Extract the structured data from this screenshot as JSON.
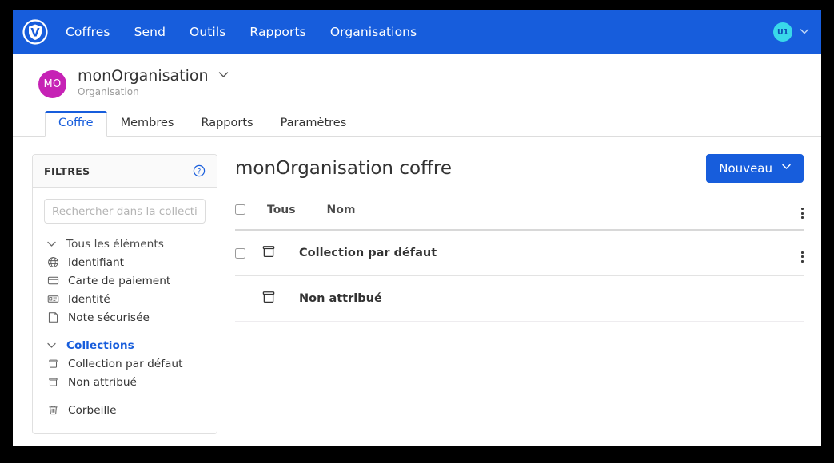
{
  "navbar": {
    "logo_icon": "bitwarden-shield-logo",
    "links": [
      {
        "label": "Coffres"
      },
      {
        "label": "Send"
      },
      {
        "label": "Outils"
      },
      {
        "label": "Rapports"
      },
      {
        "label": "Organisations"
      }
    ],
    "user_avatar_initials": "U1",
    "user_menu_icon": "chevron-down-icon",
    "background_color": "#175ddc",
    "avatar_color": "#39d8ea"
  },
  "org_header": {
    "avatar_initials": "MO",
    "avatar_color": "#c622b5",
    "name": "monOrganisation",
    "subtitle": "Organisation",
    "chevron_icon": "chevron-down-icon"
  },
  "tabs": [
    {
      "label": "Coffre",
      "active": true
    },
    {
      "label": "Membres",
      "active": false
    },
    {
      "label": "Rapports",
      "active": false
    },
    {
      "label": "Paramètres",
      "active": false
    }
  ],
  "sidebar": {
    "title": "FILTRES",
    "help_icon": "question-circle-icon",
    "search": {
      "placeholder": "Rechercher dans la collection",
      "value": ""
    },
    "groups": [
      {
        "header": {
          "label": "Tous les éléments",
          "icon": "chevron-down-icon",
          "accent": false
        },
        "items": [
          {
            "label": "Identifiant",
            "icon": "globe-icon"
          },
          {
            "label": "Carte de paiement",
            "icon": "credit-card-icon"
          },
          {
            "label": "Identité",
            "icon": "id-card-icon"
          },
          {
            "label": "Note sécurisée",
            "icon": "sticky-note-icon"
          }
        ]
      },
      {
        "header": {
          "label": "Collections",
          "icon": "chevron-down-icon",
          "accent": true
        },
        "items": [
          {
            "label": "Collection par défaut",
            "icon": "collection-icon"
          },
          {
            "label": "Non attribué",
            "icon": "collection-icon"
          }
        ]
      }
    ],
    "trash": {
      "label": "Corbeille",
      "icon": "trash-icon"
    },
    "accent_color": "#175ddc"
  },
  "main": {
    "title": "monOrganisation coffre",
    "new_button": {
      "label": "Nouveau",
      "icon": "chevron-down-icon",
      "color": "#175ddc"
    },
    "table": {
      "columns": [
        {
          "key": "select_all",
          "label": "Tous"
        },
        {
          "key": "name",
          "label": "Nom"
        }
      ],
      "header_menu_icon": "kebab-menu-icon",
      "rows": [
        {
          "name": "Collection par défaut",
          "icon": "collection-icon",
          "has_checkbox": true,
          "checked": false,
          "has_menu": true
        },
        {
          "name": "Non attribué",
          "icon": "collection-icon",
          "has_checkbox": false,
          "checked": false,
          "has_menu": false
        }
      ]
    }
  }
}
